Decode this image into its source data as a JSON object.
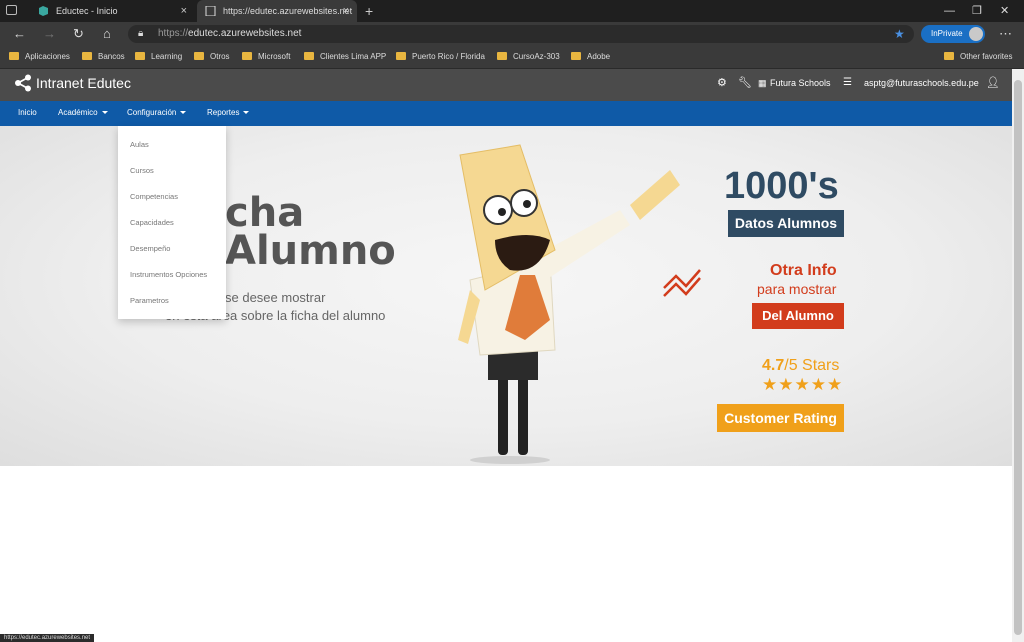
{
  "browser": {
    "tabs": [
      {
        "title": "Eductec - Inicio"
      },
      {
        "title": "https://edutec.azurewebsites.net"
      }
    ],
    "address": {
      "protocol": "https://",
      "host": "edutec.azurewebsites.net"
    },
    "inprivate_label": "InPrivate",
    "bookmarks": [
      "Aplicaciones",
      "Bancos",
      "Learning",
      "Otros",
      "Microsoft",
      "Clientes Lima APP",
      "Puerto Rico / Florida",
      "CursoAz-303",
      "Adobe"
    ],
    "other_favorites": "Other favorites",
    "status_text": "https://edutec.azurewebsites.net"
  },
  "app": {
    "title": "Intranet Edutec",
    "school": "Futura Schools",
    "user": "asptg@futuraschools.edu.pe"
  },
  "nav": {
    "items": [
      "Inicio",
      "Académico",
      "Configuración",
      "Reportes"
    ]
  },
  "dropdown": {
    "items": [
      "Aulas",
      "Cursos",
      "Competencias",
      "Capacidades",
      "Desempeño",
      "Instrumentos Opciones",
      "Parametros"
    ]
  },
  "hero": {
    "title_line1": "cha",
    "title_line2": "Alumno",
    "desc_line1": "se desee mostrar",
    "desc_line2": "en esta área sobre la ficha del alumno",
    "stat_big": "1000's",
    "stat_label": "Datos Alumnos",
    "otra_info": "Otra Info",
    "para_mostrar": "para mostrar",
    "del_alumno": "Del Alumno",
    "rating_value": "4.7",
    "rating_suffix": "/5 Stars",
    "stars": "★★★★★",
    "customer_rating": "Customer Rating"
  },
  "colors": {
    "header": "#4b4b4b",
    "navbar": "#0f5aa7",
    "navy": "#2f4b63",
    "red": "#d23c1c",
    "orange": "#f0a01a"
  }
}
